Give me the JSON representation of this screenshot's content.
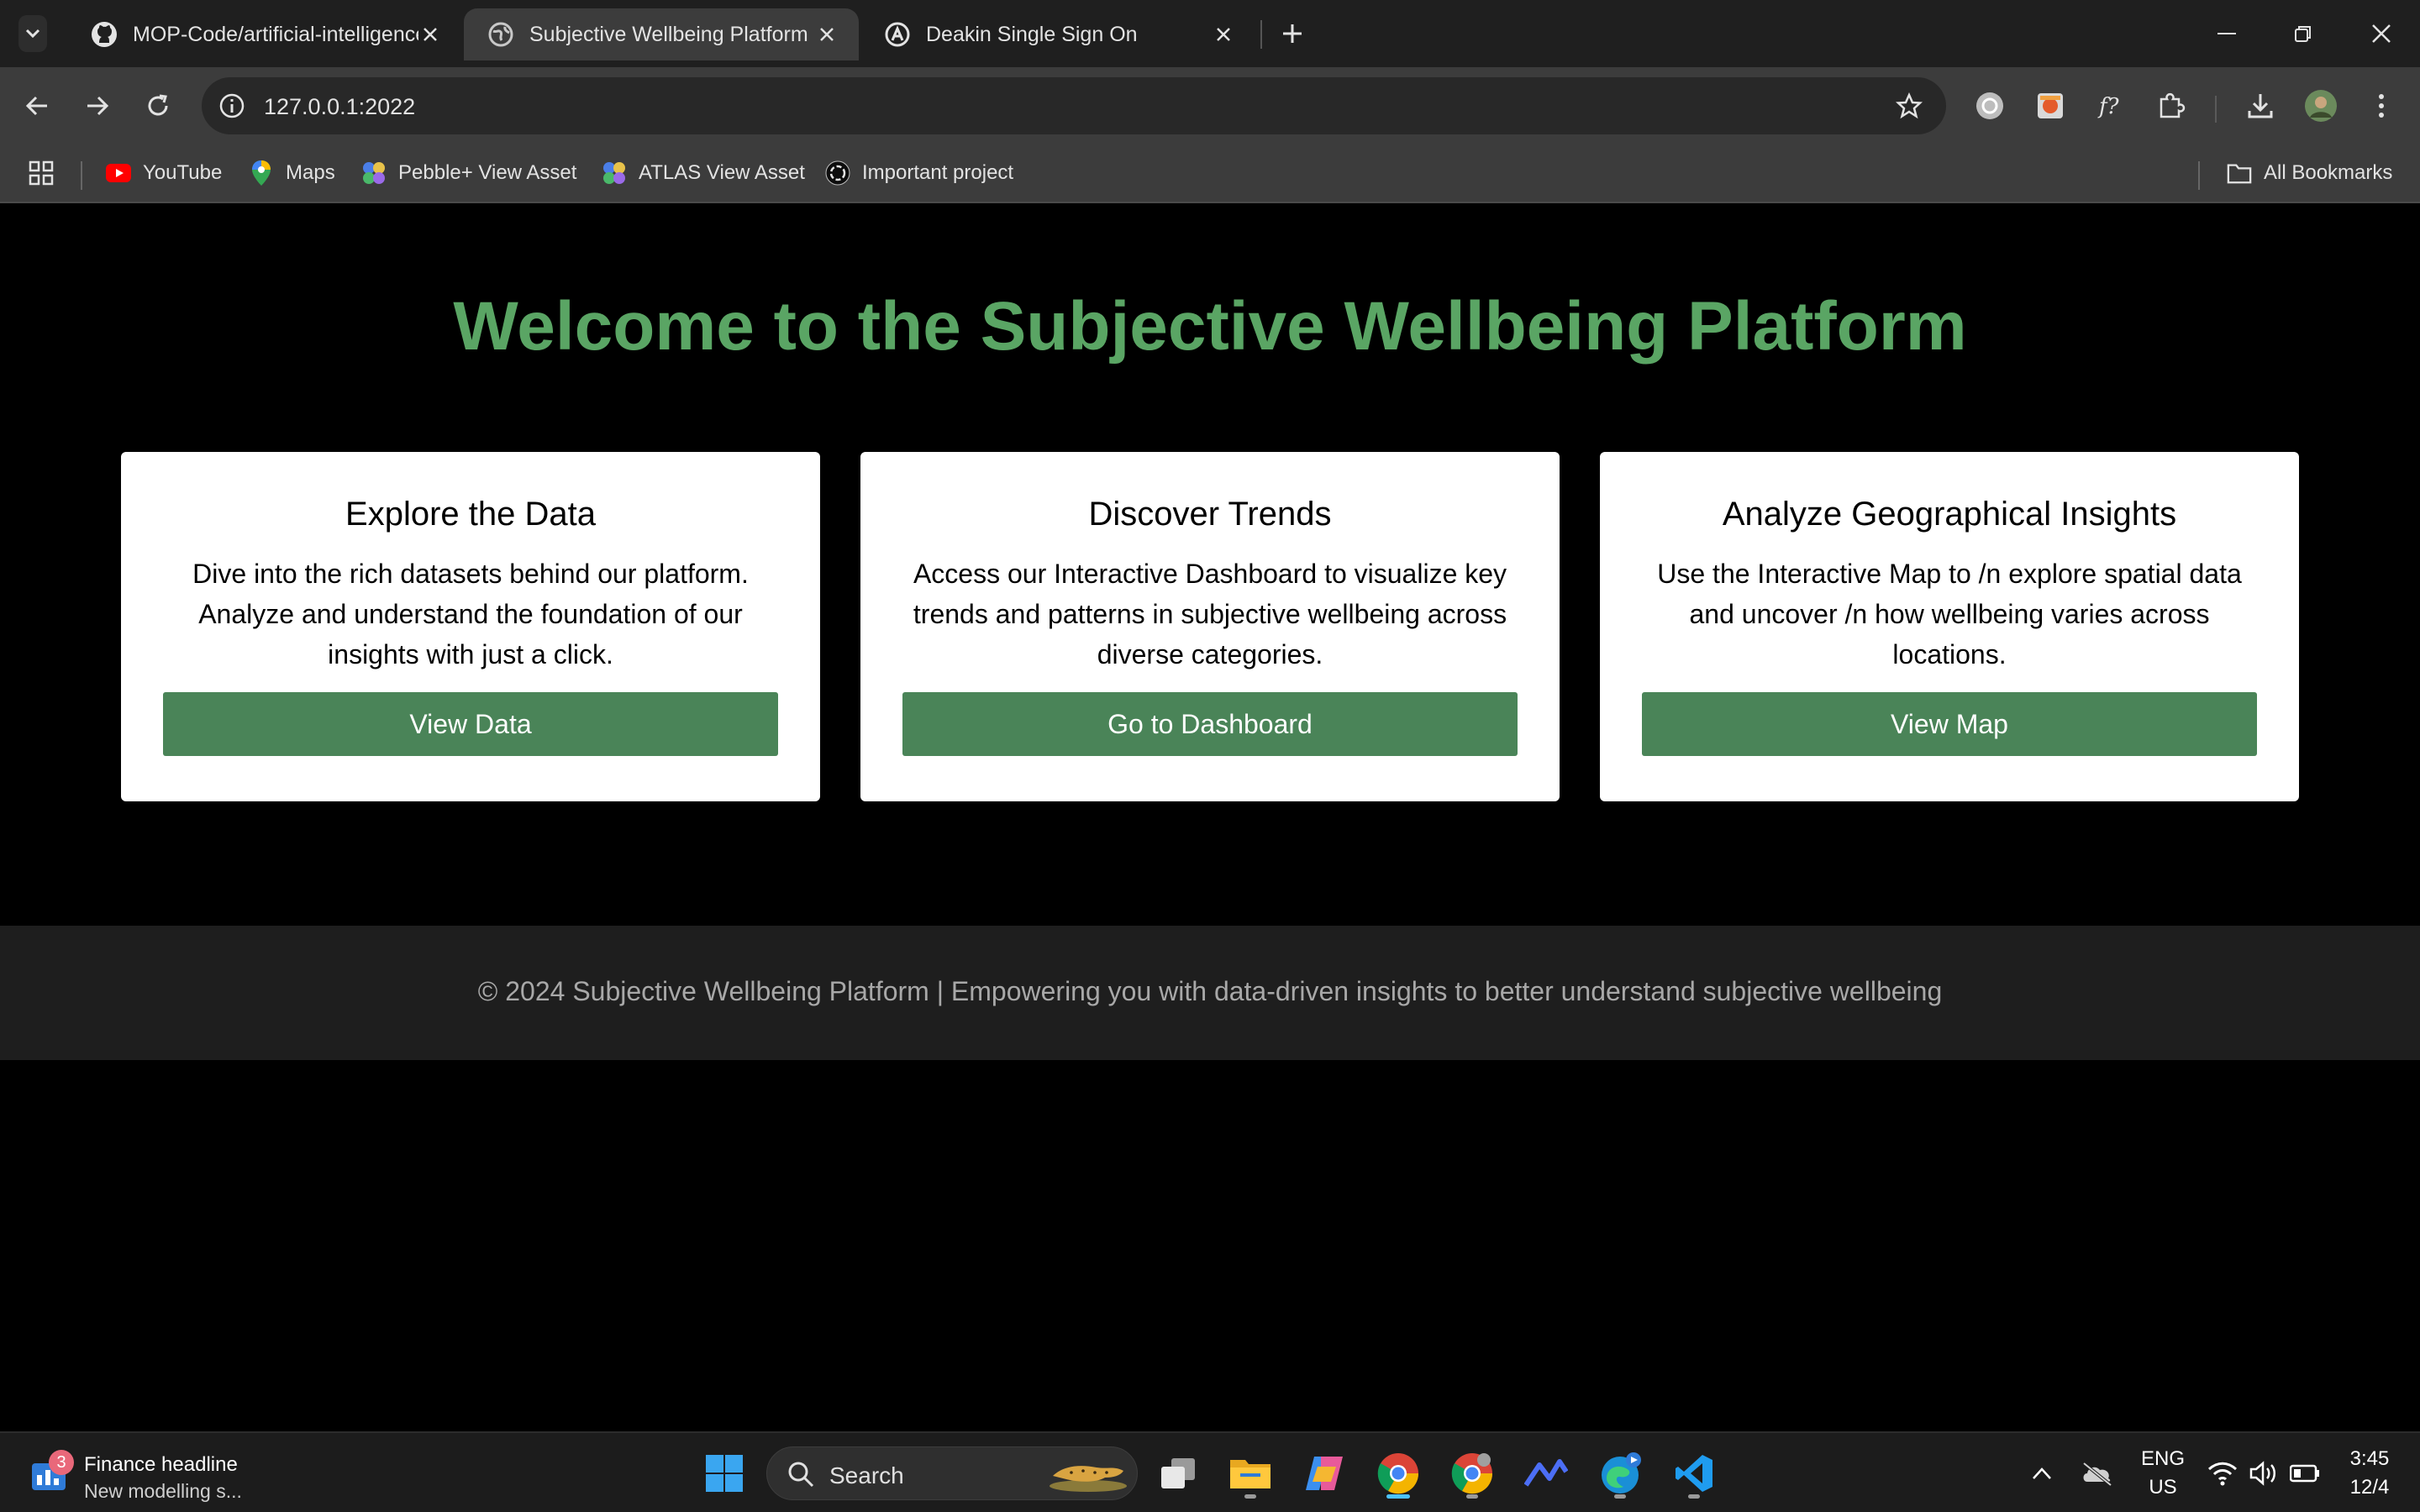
{
  "browser": {
    "tabs": [
      {
        "title": "MOP-Code/artificial-intelligence",
        "icon": "github-icon",
        "active": false
      },
      {
        "title": "Subjective Wellbeing Platform",
        "icon": "globe-icon",
        "active": true
      },
      {
        "title": "Deakin Single Sign On",
        "icon": "sso-icon",
        "active": false
      }
    ],
    "url": "127.0.0.1:2022",
    "bookmarks": [
      {
        "label": "YouTube",
        "icon": "youtube-icon"
      },
      {
        "label": "Maps",
        "icon": "maps-pin-icon"
      },
      {
        "label": "Pebble+ View Asset",
        "icon": "pebble-icon"
      },
      {
        "label": "ATLAS View Asset",
        "icon": "atlas-icon"
      },
      {
        "label": "Important project",
        "icon": "openai-icon"
      }
    ],
    "all_bookmarks_label": "All Bookmarks"
  },
  "page": {
    "heading": "Welcome to the Subjective Wellbeing Platform",
    "heading_color": "#5aa564",
    "button_color": "#4a8458",
    "cards": [
      {
        "title": "Explore the Data",
        "text": "Dive into the rich datasets behind our platform. Analyze and understand the foundation of our insights with just a click.",
        "button": "View Data"
      },
      {
        "title": "Discover Trends",
        "text": "Access our Interactive Dashboard to visualize key trends and patterns in subjective wellbeing across diverse categories.",
        "button": "Go to Dashboard"
      },
      {
        "title": "Analyze Geographical Insights",
        "text": "Use the Interactive Map to /n explore spatial data and uncover /n how wellbeing varies across locations.",
        "button": "View Map"
      }
    ],
    "footer": "© 2024 Subjective Wellbeing Platform | Empowering you with data-driven insights to better understand subjective wellbeing"
  },
  "taskbar": {
    "widget_badge": "3",
    "widget_title": "Finance headline",
    "widget_subtitle": "New modelling s...",
    "search_placeholder": "Search",
    "language": "ENG",
    "region": "US",
    "time": "3:45",
    "date": "12/4"
  }
}
